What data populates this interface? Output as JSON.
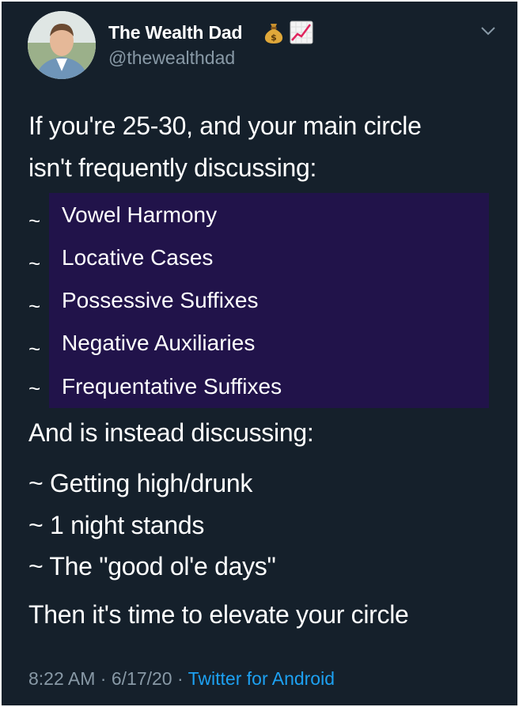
{
  "tweet": {
    "author": {
      "display_name": "The Wealth Dad",
      "handle": "@thewealthdad",
      "name_emojis": [
        "money-bag-icon",
        "chart-increasing-icon"
      ]
    },
    "text": {
      "intro_line1": "If you're 25-30, and your main circle",
      "intro_line2": "isn't frequently discussing:",
      "highlighted_items": [
        "Vowel Harmony",
        "Locative Cases",
        "Possessive Suffixes",
        "Negative Auxiliaries",
        "Frequentative Suffixes"
      ],
      "bullet": "~",
      "instead_line": "And is instead discussing:",
      "instead_items": [
        "~ Getting high/drunk",
        "~ 1 night stands",
        "~ The \"good ol'e days\""
      ],
      "closing_line": "Then it's time to elevate your circle"
    },
    "meta": {
      "time": "8:22 AM",
      "date": "6/17/20",
      "separator": "·",
      "source": "Twitter for Android"
    }
  },
  "colors": {
    "background": "#15202b",
    "text": "#ffffff",
    "secondary_text": "#8899a6",
    "link": "#1da1f2",
    "highlight_box": "#21134a"
  }
}
